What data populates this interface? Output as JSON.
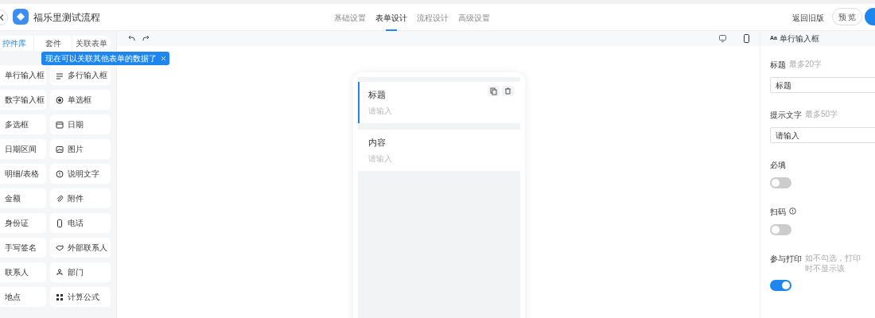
{
  "header": {
    "title": "福乐里测试流程",
    "tabs": [
      {
        "label": "基础设置",
        "selected": false
      },
      {
        "label": "表单设计",
        "selected": true
      },
      {
        "label": "流程设计",
        "selected": false
      },
      {
        "label": "高级设置",
        "selected": false
      }
    ],
    "back_old": "返回旧版",
    "preview": "预 览"
  },
  "library": {
    "tabs": [
      {
        "label": "控件库",
        "selected": true
      },
      {
        "label": "套件",
        "selected": false
      },
      {
        "label": "关联表单",
        "selected": false
      }
    ],
    "tooltip": "现在可以关联其他表单的数据了",
    "items": [
      {
        "label": "单行输入框"
      },
      {
        "label": "多行输入框"
      },
      {
        "label": "数字输入框"
      },
      {
        "label": "单选框"
      },
      {
        "label": "多选框"
      },
      {
        "label": "日期"
      },
      {
        "label": "日期区间"
      },
      {
        "label": "图片"
      },
      {
        "label": "明细/表格"
      },
      {
        "label": "说明文字"
      },
      {
        "label": "金额"
      },
      {
        "label": "附件"
      },
      {
        "label": "身份证"
      },
      {
        "label": "电话"
      },
      {
        "label": "手写签名"
      },
      {
        "label": "外部联系人"
      },
      {
        "label": "联系人"
      },
      {
        "label": "部门"
      },
      {
        "label": "地点"
      },
      {
        "label": "计算公式"
      }
    ]
  },
  "canvas": {
    "fields": [
      {
        "label": "标题",
        "placeholder": "请输入",
        "selected": true
      },
      {
        "label": "内容",
        "placeholder": "请输入",
        "selected": false
      }
    ]
  },
  "properties": {
    "title": "单行输入框",
    "title_badge": "Aa",
    "items": [
      {
        "kind": "input",
        "label": "标题",
        "hint": "最多20字",
        "value": "标题"
      },
      {
        "kind": "input",
        "label": "提示文字",
        "hint": "最多50字",
        "value": "请输入"
      },
      {
        "kind": "switch",
        "label": "必填",
        "on": false
      },
      {
        "kind": "switch",
        "label": "扫码",
        "info": true,
        "on": false
      },
      {
        "kind": "switch",
        "label": "参与打印",
        "hint": "如不勾选，打印时不显示该",
        "on": true
      }
    ]
  }
}
